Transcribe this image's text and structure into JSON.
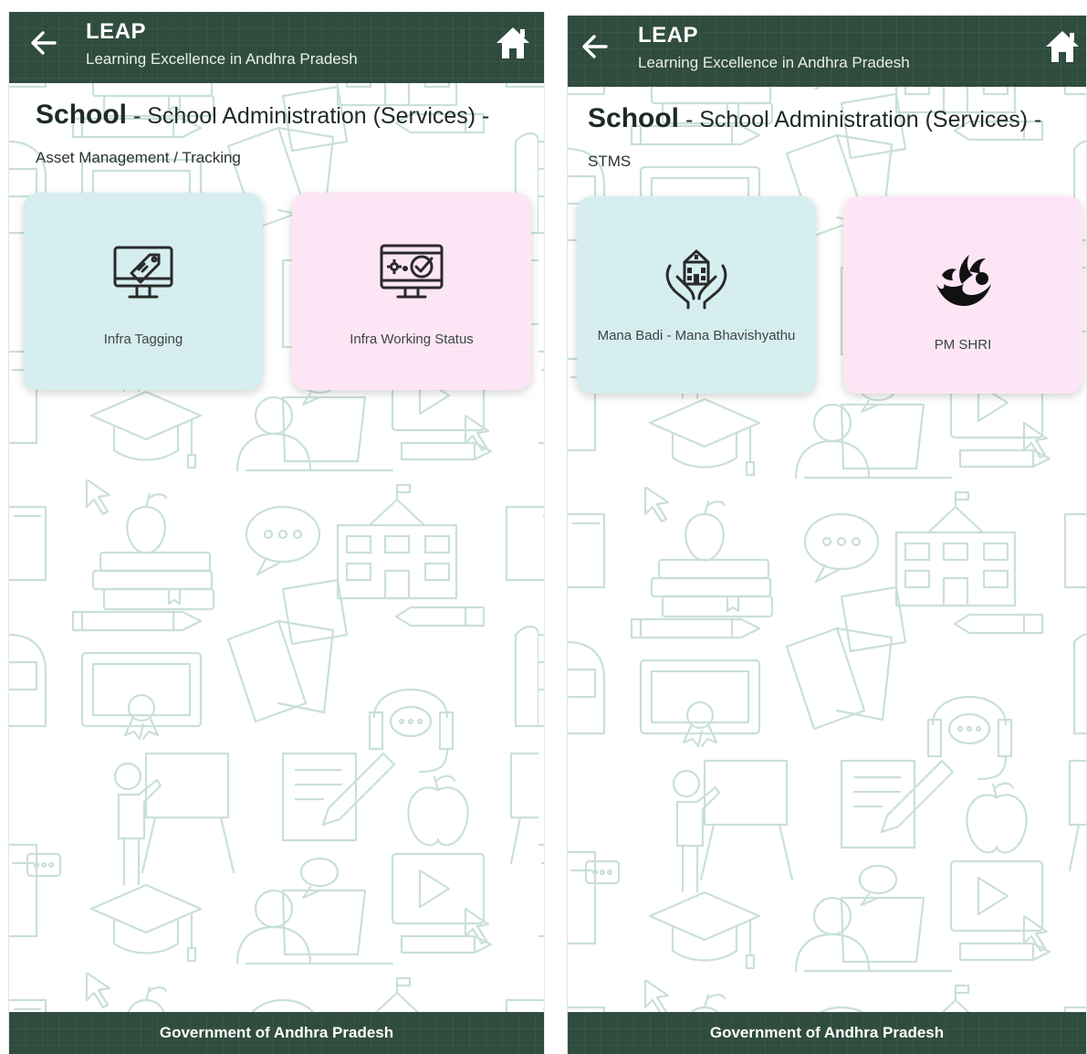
{
  "colors": {
    "header_bg": "#2f4c3e",
    "tile_blue": "#d6eef0",
    "tile_pink": "#fce6f5",
    "pattern_stroke": "#c9e0d6"
  },
  "screens": [
    {
      "app_title": "LEAP",
      "app_subtitle": "Learning Excellence in Andhra Pradesh",
      "back_icon": "arrow-left-icon",
      "home_icon": "home-icon",
      "breadcrumb_main": "School",
      "breadcrumb_rest": " - School Administration (Services) -",
      "breadcrumb_sub": "Asset Management / Tracking",
      "tiles": [
        {
          "label": "Infra Tagging",
          "icon": "monitor-tag-icon"
        },
        {
          "label": "Infra Working Status",
          "icon": "monitor-check-icon"
        }
      ],
      "footer": "Government of Andhra Pradesh"
    },
    {
      "app_title": "LEAP",
      "app_subtitle": "Learning Excellence in Andhra Pradesh",
      "back_icon": "arrow-left-icon",
      "home_icon": "home-icon",
      "breadcrumb_main": "School",
      "breadcrumb_rest": " - School Administration (Services) -",
      "breadcrumb_sub": "STMS",
      "tiles": [
        {
          "label": "Mana Badi - Mana Bhavishyathu",
          "icon": "school-hands-icon"
        },
        {
          "label": "PM SHRI",
          "icon": "pm-shri-logo-icon"
        }
      ],
      "footer": "Government of Andhra Pradesh"
    }
  ]
}
